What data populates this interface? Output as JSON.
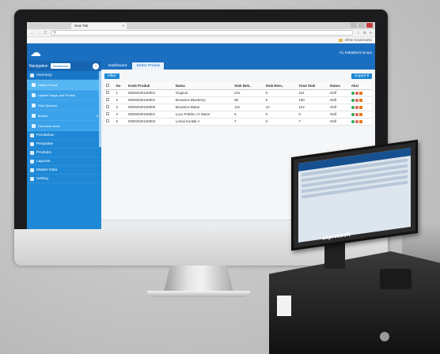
{
  "browser": {
    "tab_title": "New Tab",
    "tab_close": "×",
    "url": "q",
    "bookmarks_label": "Other bookmarks"
  },
  "app": {
    "user_label": "Hi, bekaBlock Drops",
    "navigation_label": "Navigation",
    "dashboard_label": "Dashboard"
  },
  "sidebar": {
    "items": [
      {
        "label": "Inventory"
      },
      {
        "label": "Daftar Produk",
        "sub": true
      },
      {
        "label": "Update Harga Jual Produk",
        "sub": true
      },
      {
        "label": "Stok Opname",
        "sub": true
      },
      {
        "label": "Mutasi",
        "sub": true
      },
      {
        "label": "Cek kartu stock",
        "sub": true
      },
      {
        "label": "Pembelian"
      },
      {
        "label": "Penjualan"
      },
      {
        "label": "Produksi"
      },
      {
        "label": "Laporan"
      },
      {
        "label": "Master Data"
      },
      {
        "label": "Setting"
      }
    ]
  },
  "main": {
    "tabs": [
      {
        "label": "Dashboard"
      },
      {
        "label": "Daftar Produk"
      }
    ],
    "filter_label": "Filter",
    "export_label": "Export ▾"
  },
  "table": {
    "headers": [
      "",
      "No",
      "Kode Produk",
      "Nama",
      "Stok Bek..",
      "Stok Rem..",
      "Total Stok",
      "Status",
      "Aksi"
    ],
    "rows": [
      [
        "1",
        "00094020160001",
        "Original",
        "241",
        "0",
        "241",
        "Aktif"
      ],
      [
        "2",
        "00094020160001",
        "Brownies Blueberry",
        "95",
        "5",
        "100",
        "Aktif"
      ],
      [
        "3",
        "00094020160009",
        "Brownies Bakar",
        "112",
        "10",
        "122",
        "Aktif"
      ],
      [
        "4",
        "00094020160001",
        "Lucu Prabhu 17 Maret",
        "6",
        "0",
        "0",
        "Aktif"
      ],
      [
        "5",
        "00094020160002",
        "Lemai Kontak A",
        "7",
        "3",
        "7",
        "Aktif"
      ]
    ]
  },
  "pos": {
    "brand": "expressoft"
  },
  "colors": {
    "primary": "#1b6fc0",
    "sidebar": "#1e88d6"
  }
}
